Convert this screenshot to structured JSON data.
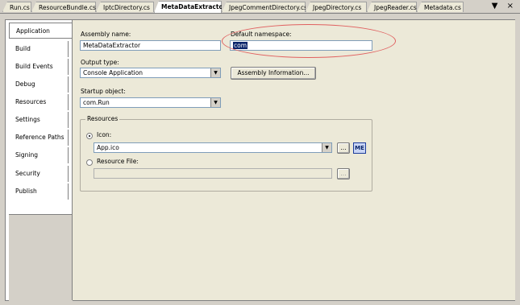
{
  "tabs": [
    {
      "label": "Run.cs"
    },
    {
      "label": "ResourceBundle.cs"
    },
    {
      "label": "IptcDirectory.cs"
    },
    {
      "label": "MetaDataExtractor"
    },
    {
      "label": "JpegCommentDirectory.cs"
    },
    {
      "label": "JpegDirectory.cs"
    },
    {
      "label": "JpegReader.cs"
    },
    {
      "label": "Metadata.cs"
    }
  ],
  "tab_controls": "▼ ×",
  "nav": [
    "Application",
    "Build",
    "Build Events",
    "Debug",
    "Resources",
    "Settings",
    "Reference Paths",
    "Signing",
    "Security",
    "Publish"
  ],
  "form": {
    "assembly_name_label": "Assembly name:",
    "assembly_name_value": "MetaDataExtractor",
    "default_namespace_label": "Default namespace:",
    "default_namespace_value": "com",
    "output_type_label": "Output type:",
    "output_type_value": "Console Application",
    "assembly_info_button": "Assembly Information...",
    "startup_object_label": "Startup object:",
    "startup_object_value": "com.Run",
    "resources_group": "Resources",
    "icon_label": "Icon:",
    "icon_value": "App.ico",
    "browse": "...",
    "resource_file_label": "Resource File:",
    "resource_file_value": "",
    "icon_preview": "ME"
  },
  "colors": {
    "highlight_ellipse": "#e06060",
    "selection": "#0a246a"
  }
}
